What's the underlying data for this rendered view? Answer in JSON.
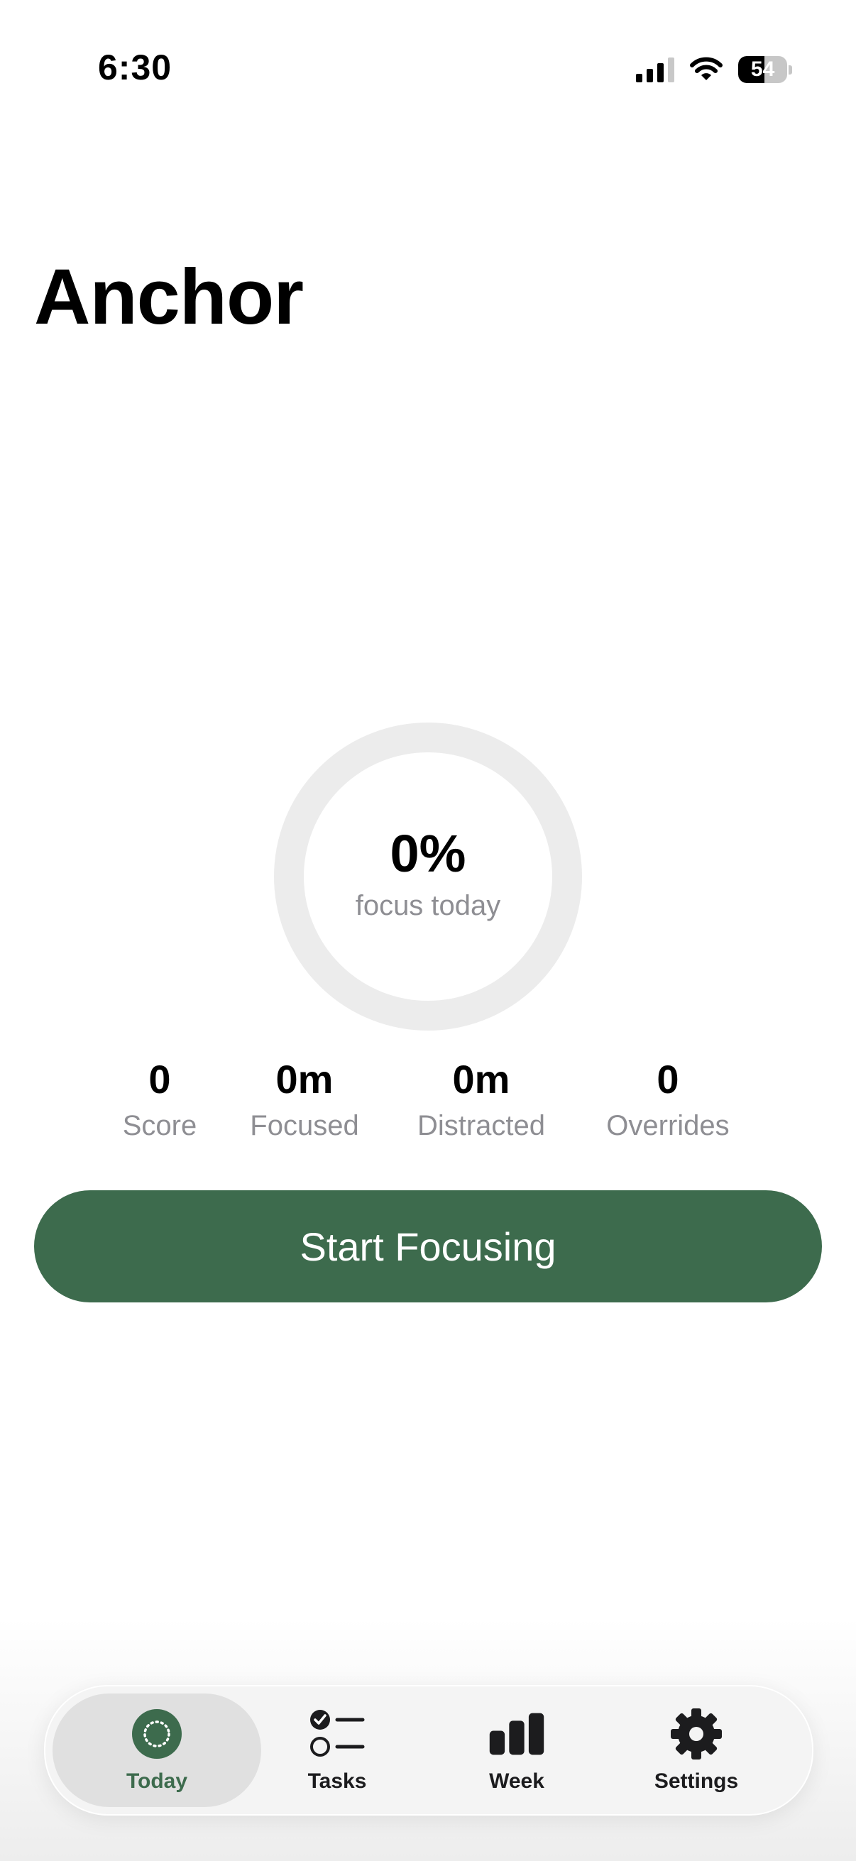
{
  "status_bar": {
    "time": "6:30",
    "battery": "54",
    "battery_level": 0.54,
    "signal_icon": "cellular-signal-icon",
    "wifi_icon": "wifi-icon"
  },
  "header": {
    "title": "Anchor"
  },
  "focus_ring": {
    "percent_text": "0%",
    "progress": 0,
    "caption": "focus today",
    "track_color": "#ececec",
    "progress_color": "#3d6b4d"
  },
  "stats": [
    {
      "value": "0",
      "label": "Score"
    },
    {
      "value": "0m",
      "label": "Focused"
    },
    {
      "value": "0m",
      "label": "Distracted"
    },
    {
      "value": "0",
      "label": "Overrides"
    }
  ],
  "primary_action": {
    "label": "Start Focusing",
    "color": "#3d6b4d"
  },
  "tab_bar": {
    "active": "Today",
    "tabs": [
      {
        "label": "Today",
        "icon": "focus-circle-icon"
      },
      {
        "label": "Tasks",
        "icon": "checklist-icon"
      },
      {
        "label": "Week",
        "icon": "bar-chart-icon"
      },
      {
        "label": "Settings",
        "icon": "gear-icon"
      }
    ]
  }
}
